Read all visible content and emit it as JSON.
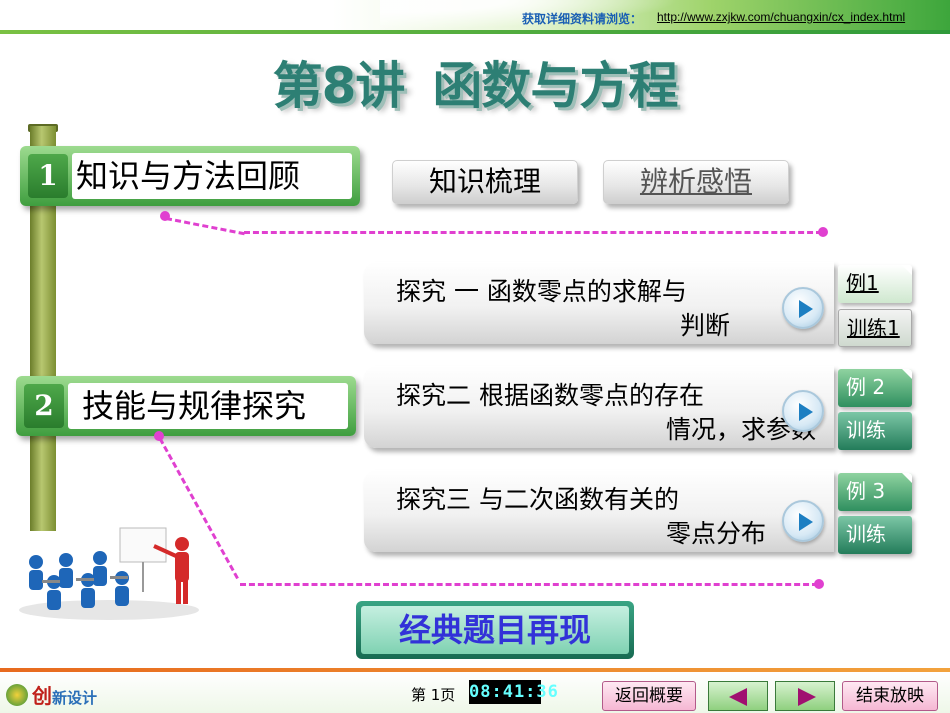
{
  "header": {
    "source_label": "获取详细资料请浏览：",
    "source_url": "http://www.zxjkw.com/chuangxin/cx_index.html"
  },
  "title": {
    "lesson": "第8讲",
    "topic": "函数与方程"
  },
  "sections": [
    {
      "number": "1",
      "label": "知识与方法回顾"
    },
    {
      "number": "2",
      "label": "技能与规律探究"
    }
  ],
  "tabs": [
    {
      "label": "知识梳理"
    },
    {
      "label": "辨析感悟"
    }
  ],
  "inquiries": [
    {
      "line1": "探究 一    函数零点的求解与",
      "line2": "判断"
    },
    {
      "line1": "探究二    根据函数零点的存在",
      "line2": "情况，求参数"
    },
    {
      "line1": "探究三    与二次函数有关的",
      "line2": "零点分布"
    }
  ],
  "tags": [
    {
      "label": "例1"
    },
    {
      "label": "训练1"
    },
    {
      "label": "例 2"
    },
    {
      "label": "训练"
    },
    {
      "label": "例 3"
    },
    {
      "label": "训练"
    }
  ],
  "classic_button": "经典题目再现",
  "footer": {
    "logo_main": "创",
    "logo_sub": "新设计",
    "page_number": "第 1页",
    "clock": "08:41:36",
    "back_label": "返回概要",
    "end_label": "结束放映"
  },
  "colors": {
    "title": "#2d7f74",
    "section_green": "#3f9e3f",
    "dash_magenta": "#e040d0",
    "classic_text": "#3232d8"
  }
}
